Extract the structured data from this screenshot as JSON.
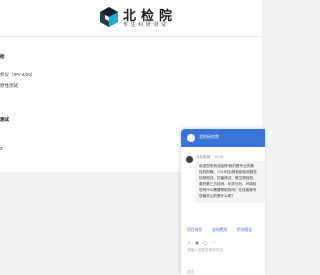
{
  "header": {
    "brand": "北检院",
    "subtitle": "专注科研测试"
  },
  "sidebar": {
    "line1": "检",
    "line2": "析仪（IPV-4/20）",
    "line3": "原性测试",
    "line4": "测试",
    "line5": "3"
  },
  "chat": {
    "title": "北检研究院",
    "sender": "北检客服",
    "time": "10:38",
    "bubble_lines": [
      "欢迎您来到北检院!我们是专业的第",
      "检机构哦，72小时出具检验检测报告",
      "检测测试、抗菌测试、微生物检测、",
      "委托第三方检测、化学分析、环境检",
      "您有什么需要帮助的吗？在线客服专",
      "您最关心的是什么呢？"
    ],
    "quick_replies": [
      "项目推荐",
      "咨询费用",
      "检测报告"
    ],
    "tools": [
      "☺",
      "▣",
      "◯",
      "⋯"
    ],
    "input_placeholder": "请输入您要咨询的内容...",
    "send_hint": "发送"
  }
}
